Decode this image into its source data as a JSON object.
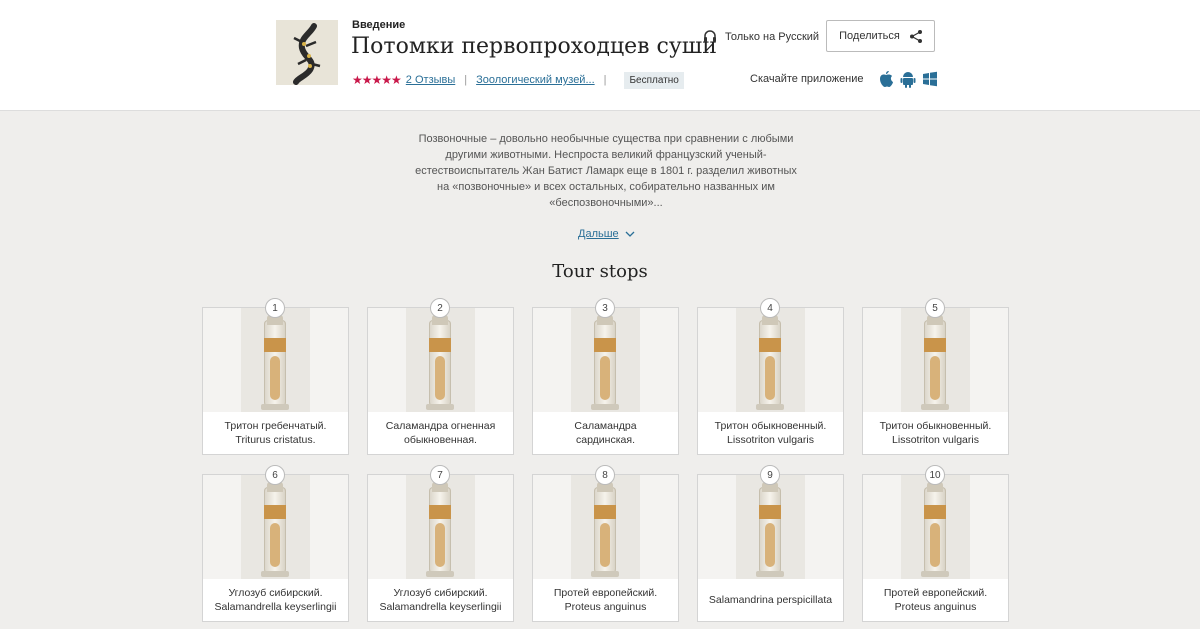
{
  "header": {
    "eyebrow": "Введение",
    "title": "Потомки первопроходцев суши",
    "rating_stars": "★★★★★",
    "reviews_link": "2 Отзывы",
    "museum_link": "Зоологический музей...",
    "badge": "Бесплатно",
    "audio_language": "Только на Русский",
    "share_label": "Поделиться",
    "download_label": "Скачайте приложение",
    "platform_icons": [
      "apple-icon",
      "android-icon",
      "windows-icon"
    ],
    "accent_color": "#c9184a",
    "link_color": "#2a6f97"
  },
  "description": {
    "text": "Позвоночные – довольно необычные существа при сравнении с любыми другими животными. Неспроста великий французский ученый-естествоиспытатель Жан Батист Ламарк еще в 1801 г. разделил животных на «позвоночные» и всех остальных, собирательно названных им «беспозвоночными»...",
    "more_label": "Дальше"
  },
  "stops": {
    "title": "Tour stops",
    "items": [
      {
        "number": "1",
        "line1": "Тритон гребенчатый.",
        "line2": "Triturus cristatus."
      },
      {
        "number": "2",
        "line1": "Саламандра огненная",
        "line2": "обыкновенная."
      },
      {
        "number": "3",
        "line1": "Саламандра",
        "line2": "сардинская."
      },
      {
        "number": "4",
        "line1": "Тритон обыкновенный.",
        "line2": "Lissotriton vulgaris"
      },
      {
        "number": "5",
        "line1": "Тритон обыкновенный.",
        "line2": "Lissotriton vulgaris"
      },
      {
        "number": "6",
        "line1": "Углозуб сибирский.",
        "line2": "Salamandrella keyserlingii"
      },
      {
        "number": "7",
        "line1": "Углозуб сибирский.",
        "line2": "Salamandrella keyserlingii"
      },
      {
        "number": "8",
        "line1": "Протей европейский.",
        "line2": "Proteus anguinus"
      },
      {
        "number": "9",
        "line1": "Salamandrina perspicillata",
        "line2": ""
      },
      {
        "number": "10",
        "line1": "Протей европейский.",
        "line2": "Proteus anguinus"
      }
    ]
  }
}
